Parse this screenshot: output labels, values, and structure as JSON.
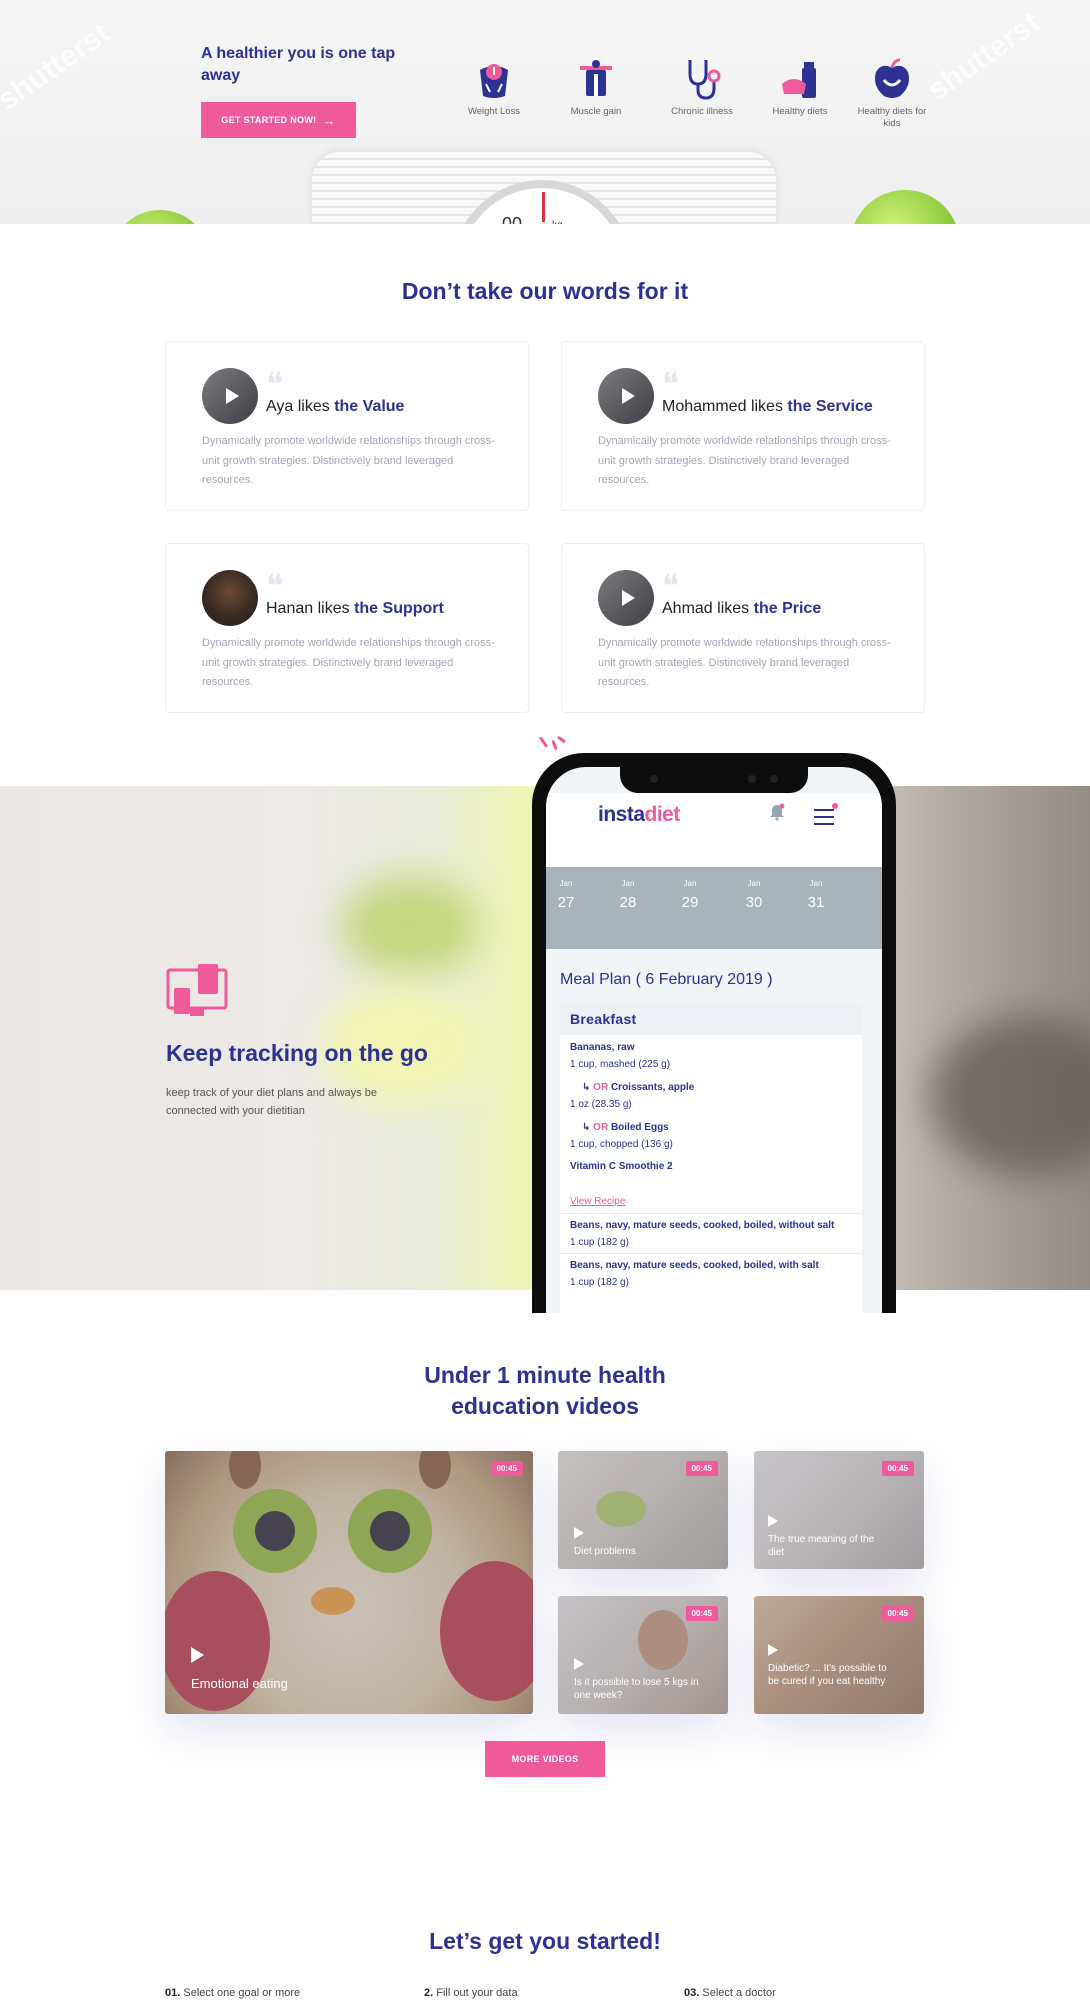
{
  "hero": {
    "title": "A healthier you is one tap away",
    "cta_label": "GET STARTED NOW!",
    "goals": [
      {
        "label": "Weight Loss",
        "icon": "weight-loss-icon"
      },
      {
        "label": "Muscle gain",
        "icon": "muscle-gain-icon"
      },
      {
        "label": "Chronic illness",
        "icon": "stethoscope-icon"
      },
      {
        "label": "Healthy diets",
        "icon": "healthy-diets-icon"
      },
      {
        "label": "Healthy diets for kids",
        "icon": "apple-icon"
      }
    ]
  },
  "testimonials": {
    "title": "Don’t take our words for it",
    "items": [
      {
        "name": "Aya",
        "likes": "likes",
        "what": "the Value",
        "text": "Dynamically promote worldwide relationships through cross-unit growth strategies. Distinctively brand leveraged resources."
      },
      {
        "name": "Mohammed",
        "likes": "likes",
        "what": "the Service",
        "text": "Dynamically promote worldwide relationships through cross-unit growth strategies. Distinctively brand leveraged resources."
      },
      {
        "name": "Hanan",
        "likes": "likes",
        "what": "the Support",
        "text": "Dynamically promote worldwide relationships through cross-unit growth strategies. Distinctively brand leveraged resources."
      },
      {
        "name": "Ahmad",
        "likes": "likes",
        "what": "the Price",
        "text": "Dynamically promote worldwide relationships through cross-unit growth strategies. Distinctively brand leveraged resources."
      }
    ]
  },
  "tracking": {
    "title": "Keep tracking on the go",
    "text": "keep track of your diet plans and always be connected with your dietitian"
  },
  "app": {
    "logo_a": "insta",
    "logo_b": "diet",
    "dates": [
      {
        "month": "Jan",
        "day": "27"
      },
      {
        "month": "Jan",
        "day": "28"
      },
      {
        "month": "Jan",
        "day": "29"
      },
      {
        "month": "Jan",
        "day": "30"
      },
      {
        "month": "Jan",
        "day": "31"
      }
    ],
    "meal_plan_title": "Meal Plan ( 6 February 2019 )",
    "meal_section": "Breakfast",
    "items": {
      "i1_name": "Bananas, raw",
      "i1_qty": "1 cup, mashed (225 g)",
      "or_label": "OR",
      "i2_name": "Croissants, apple",
      "i2_qty": "1 oz (28.35 g)",
      "i3_name": "Boiled Eggs",
      "i3_qty": "1 cup, chopped (136 g)",
      "i4_name": "Vitamin C Smoothie 2",
      "view_recipe": "View Recipe",
      "i5_name": "Beans, navy, mature seeds, cooked, boiled, without salt",
      "i5_qty": "1 cup (182 g)",
      "i6_name": "Beans, navy, mature seeds, cooked, boiled, with salt",
      "i6_qty": "1 cup (182 g)"
    }
  },
  "videos": {
    "title_line1": "Under 1 minute health",
    "title_line2": "education videos",
    "duration": "00:45",
    "items": [
      {
        "label": "Emotional eating"
      },
      {
        "label": "Diet problems"
      },
      {
        "label": "The true meaning of the diet"
      },
      {
        "label": "Is it possible to lose 5 kgs in one week?"
      },
      {
        "label": "Diabetic? ... It's possible to be cured if you eat healthy"
      }
    ],
    "more_label": "MORE VIDEOS"
  },
  "start": {
    "title": "Let’s get you started!",
    "steps": [
      {
        "num": "01.",
        "text": "Select one goal or more"
      },
      {
        "num": "2.",
        "text": "Fill out your data"
      },
      {
        "num": "03.",
        "text": "Select a doctor"
      }
    ]
  },
  "colors": {
    "primary": "#2d3192",
    "accent": "#ee5a9a"
  }
}
